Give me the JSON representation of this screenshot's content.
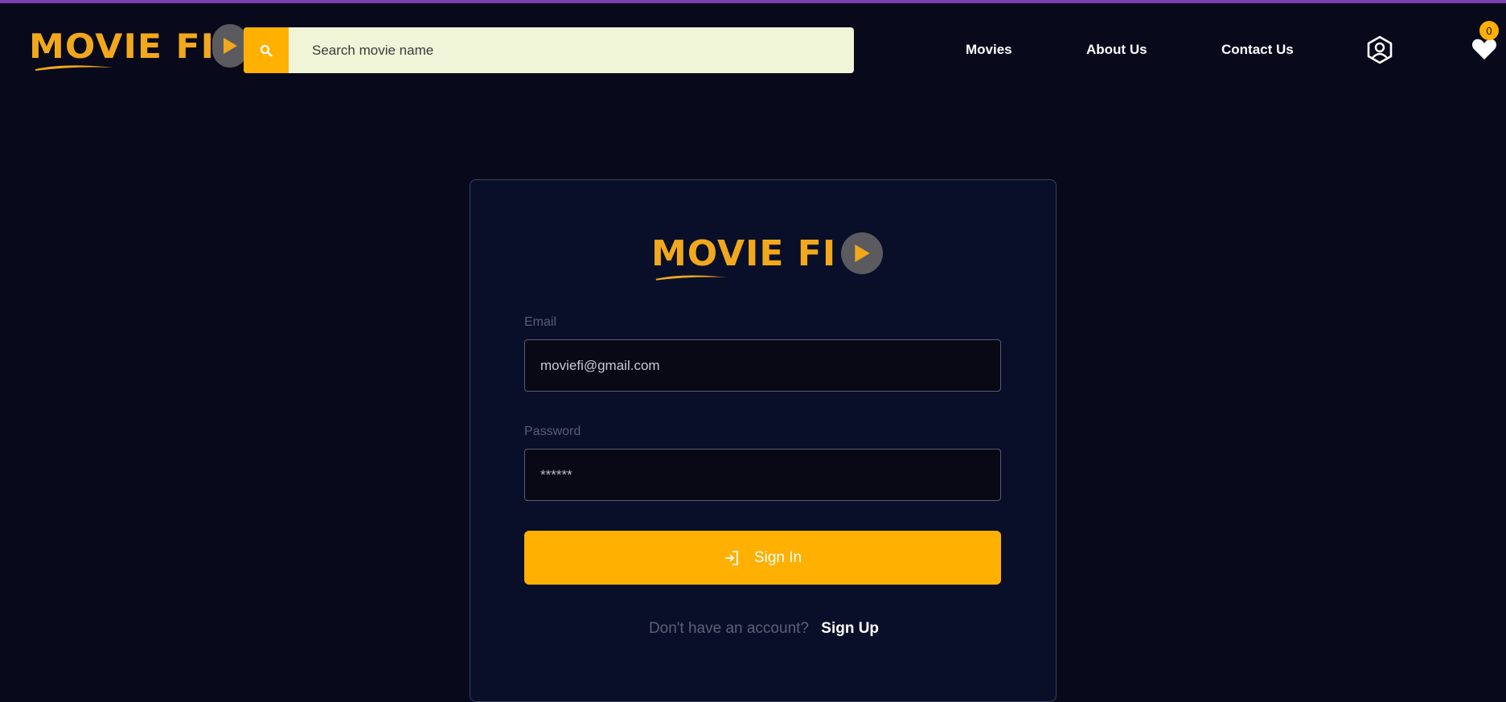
{
  "header": {
    "logo_text": "MOVIE FI",
    "search": {
      "placeholder": "Search movie name",
      "value": ""
    },
    "nav": [
      {
        "label": "Movies"
      },
      {
        "label": "About Us"
      },
      {
        "label": "Contact Us"
      }
    ],
    "wishlist_count": "0",
    "icons": [
      "search-icon",
      "user-icon",
      "heart-icon",
      "play-icon"
    ]
  },
  "login": {
    "logo_text": "MOVIE FI",
    "email_label": "Email",
    "email_value": "moviefi@gmail.com",
    "password_label": "Password",
    "password_placeholder": "******",
    "signin_label": "Sign In",
    "signup_prompt": "Don't have an account?",
    "signup_link": "Sign Up"
  },
  "colors": {
    "background": "#080a1b",
    "card": "#0a0f29",
    "accent": "#ffb000",
    "logo": "#f2a81c",
    "top_bar": "#7b3fb0",
    "search_bg": "#f1f5d8"
  }
}
